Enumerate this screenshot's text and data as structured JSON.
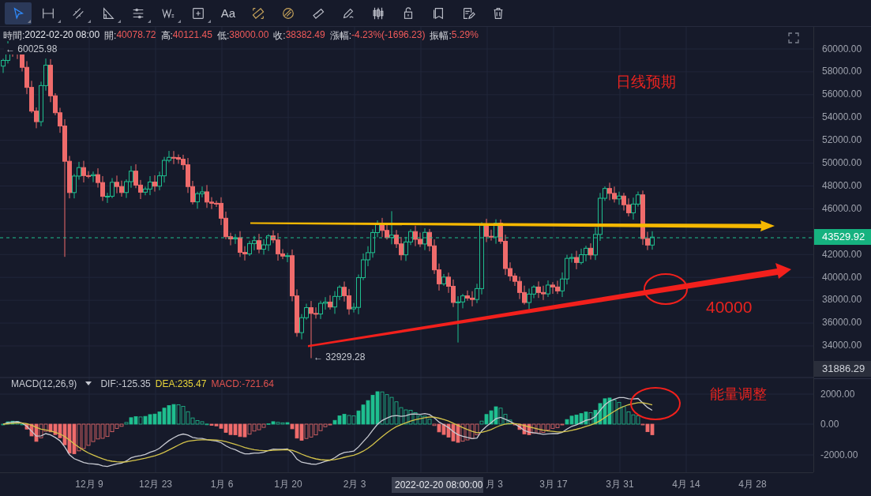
{
  "toolbar": {
    "tools": [
      {
        "selected": true,
        "has_menu": true
      },
      {
        "selected": false,
        "has_menu": true
      },
      {
        "selected": false,
        "has_menu": true
      },
      {
        "selected": false,
        "has_menu": true
      },
      {
        "selected": false,
        "has_menu": true
      },
      {
        "selected": false,
        "has_menu": true
      },
      {
        "selected": false,
        "has_menu": true
      },
      {
        "label": "Aa",
        "selected": false,
        "has_menu": false
      },
      {
        "selected": false,
        "has_menu": false
      },
      {
        "selected": false,
        "has_menu": false
      },
      {
        "selected": false,
        "has_menu": false
      },
      {
        "selected": false,
        "has_menu": false
      },
      {
        "selected": false,
        "has_menu": false
      },
      {
        "selected": false,
        "has_menu": false
      },
      {
        "selected": false,
        "has_menu": false
      },
      {
        "selected": false,
        "has_menu": false
      },
      {
        "selected": false,
        "has_menu": false
      }
    ]
  },
  "info_bar": [
    {
      "label": "時間:",
      "value": "2022-02-20 08:00",
      "color": "#e6e8ee"
    },
    {
      "label": "開:",
      "value": "40078.72",
      "color": "#ef5a5a"
    },
    {
      "label": "高:",
      "value": "40121.45",
      "color": "#ef5a5a"
    },
    {
      "label": "低:",
      "value": "38000.00",
      "color": "#ef5a5a"
    },
    {
      "label": "收:",
      "value": "38382.49",
      "color": "#ef5a5a"
    },
    {
      "label": "漲幅:",
      "value": "-4.23%(-1696.23)",
      "color": "#ef5a5a"
    },
    {
      "label": "振幅:",
      "value": "5.29%",
      "color": "#ef5a5a"
    }
  ],
  "high_marker": "← 60025.98",
  "low_marker": "← 32929.28",
  "annotations": [
    "日线预期",
    "40000",
    "能量调整"
  ],
  "macd": {
    "legend": [
      {
        "text": "MACD(12,26,9)",
        "color": "#c5c8d0",
        "has_menu": true
      },
      {
        "text": "DIF:-125.35",
        "color": "#c5c8d0",
        "has_menu": false
      },
      {
        "text": "DEA:235.47",
        "color": "#e6d33a",
        "has_menu": false
      },
      {
        "text": "MACD:-721.64",
        "color": "#e0524f",
        "has_menu": false
      }
    ]
  },
  "price_axis": {
    "ticks_above": [
      "60000.00",
      "58000.00",
      "56000.00",
      "54000.00",
      "52000.00",
      "50000.00",
      "48000.00",
      "46000.00"
    ],
    "current_price": "43529.92",
    "ticks_below": [
      "42000.00",
      "40000.00",
      "38000.00",
      "36000.00",
      "34000.00"
    ],
    "range_low": "31886.29",
    "macd_ticks": [
      "2000.00",
      "0.00",
      "-2000.00"
    ]
  },
  "time_axis": {
    "labels_before": [
      "12月 9",
      "12月 23",
      "1月 6",
      "1月 20",
      "2月 3"
    ],
    "crosshair": "2022-02-20 08:00:00",
    "labels_after": [
      "月 3",
      "3月 17",
      "3月 31",
      "4月 14",
      "4月 28"
    ]
  }
}
